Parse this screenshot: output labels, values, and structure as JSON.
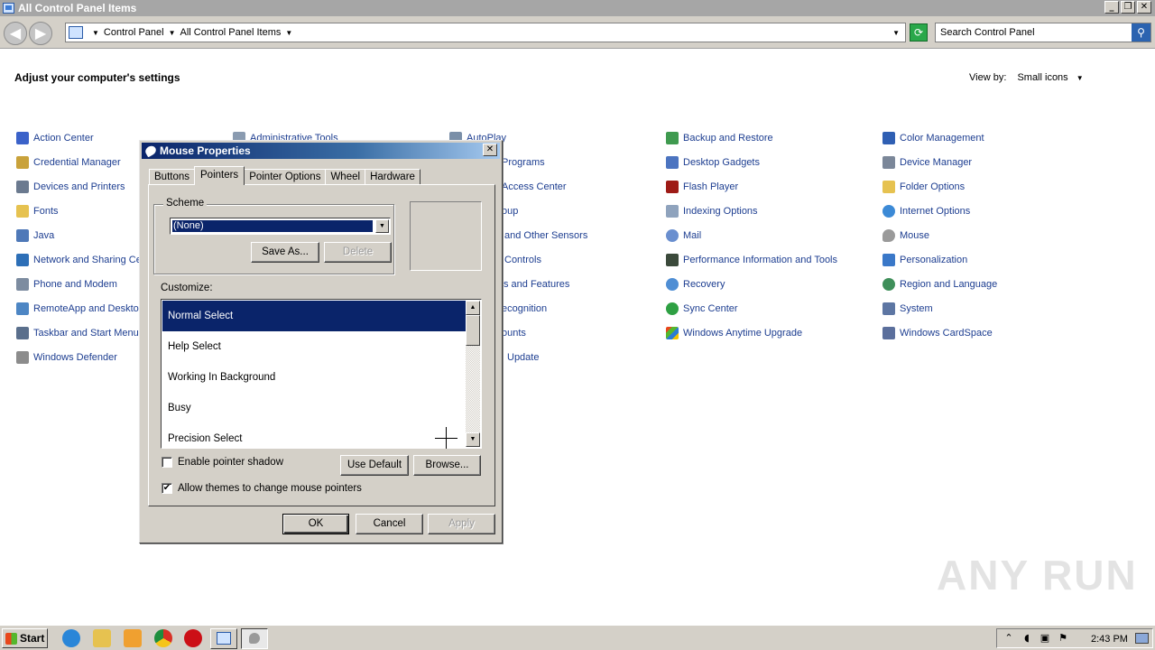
{
  "window": {
    "title": "All Control Panel Items"
  },
  "window_buttons": {
    "minimize": "_",
    "restore": "❐",
    "close": "✕"
  },
  "address": {
    "breadcrumbs": [
      "Control Panel",
      "All Control Panel Items"
    ],
    "search_placeholder": "Search Control Panel"
  },
  "content": {
    "heading": "Adjust your computer's settings",
    "view_by_label": "View by:",
    "view_by_value": "Small icons",
    "items": [
      [
        "Action Center",
        "Credential Manager",
        "Devices and Printers",
        "Fonts",
        "Java",
        "Network and Sharing Center",
        "Phone and Modem",
        "RemoteApp and Desktop Connections",
        "Taskbar and Start Menu",
        "Windows Defender"
      ],
      [
        "Administrative Tools"
      ],
      [
        "AutoPlay",
        "Programs",
        "Access Center",
        "oup",
        "and Other Sensors",
        "Controls",
        "s and Features",
        "ecognition",
        "ounts",
        "Update"
      ],
      [
        "Backup and Restore",
        "Desktop Gadgets",
        "Flash Player",
        "Indexing Options",
        "Mail",
        "Performance Information and Tools",
        "Recovery",
        "Sync Center",
        "Windows Anytime Upgrade"
      ],
      [
        "Color Management",
        "Device Manager",
        "Folder Options",
        "Internet Options",
        "Mouse",
        "Personalization",
        "Region and Language",
        "System",
        "Windows CardSpace"
      ]
    ]
  },
  "dialog": {
    "title": "Mouse Properties",
    "close_glyph": "✕",
    "tabs": [
      "Buttons",
      "Pointers",
      "Pointer Options",
      "Wheel",
      "Hardware"
    ],
    "active_tab": "Pointers",
    "scheme_label": "Scheme",
    "scheme_value": "(None)",
    "save_as": "Save As...",
    "delete": "Delete",
    "customize_label": "Customize:",
    "pointers": [
      "Normal Select",
      "Help Select",
      "Working In Background",
      "Busy",
      "Precision Select"
    ],
    "selected_pointer": "Normal Select",
    "enable_shadow": "Enable pointer shadow",
    "enable_shadow_checked": false,
    "allow_themes": "Allow themes to change mouse pointers",
    "allow_themes_checked": true,
    "allow_themes_mark": "✔",
    "use_default": "Use Default",
    "browse": "Browse...",
    "ok": "OK",
    "cancel": "Cancel",
    "apply": "Apply"
  },
  "watermark": "ANY RUN",
  "taskbar": {
    "start": "Start",
    "clock": "2:43 PM"
  },
  "colors": {
    "link": "#1c3d90",
    "selection": "#0a246a",
    "chrome": "#d4d0c8"
  }
}
